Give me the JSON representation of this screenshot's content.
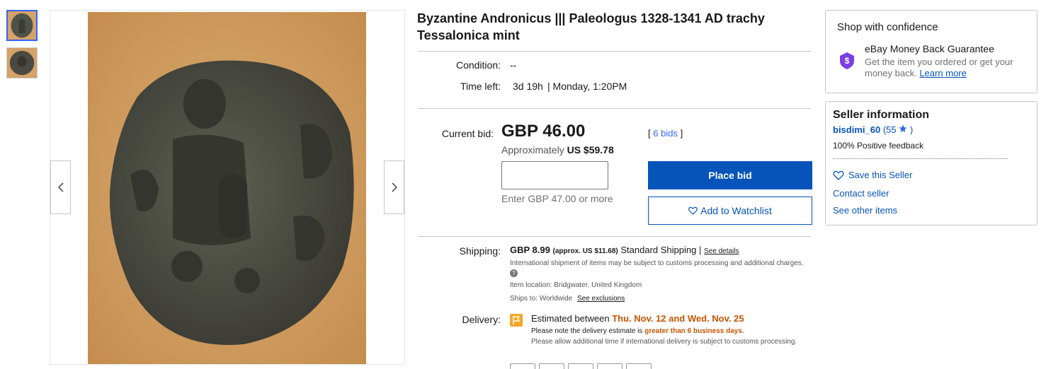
{
  "gallery": {
    "prev_icon": "chevron-left-icon",
    "next_icon": "chevron-right-icon"
  },
  "listing": {
    "title": "Byzantine Andronicus ||| Paleologus 1328-1341 AD trachy Tessalonica mint",
    "condition_label": "Condition:",
    "condition_value": "--",
    "time_left_label": "Time left:",
    "time_left_value": "3d 19h",
    "end_time": "| Monday, 1:20PM"
  },
  "bid": {
    "current_label": "Current bid:",
    "price": "GBP 46.00",
    "approx_prefix": "Approximately",
    "approx_value": "US $59.78",
    "bids_open": "[",
    "bids_link": "6 bids",
    "bids_close": "]",
    "input_value": "",
    "hint": "Enter GBP 47.00 or more",
    "place_bid": "Place bid",
    "watchlist": "Add to Watchlist"
  },
  "shipping": {
    "label": "Shipping:",
    "price": "GBP 8.99",
    "approx": "(approx. US $11.68)",
    "method": "Standard Shipping",
    "sep": "|",
    "details_link": "See details",
    "intl_note": "International shipment of items may be subject to customs processing and additional charges.",
    "location_label": "Item location:",
    "location_value": "Bridgwater, United Kingdom",
    "ships_label": "Ships to:",
    "ships_value": "Worldwide",
    "exclusions_link": "See exclusions"
  },
  "delivery": {
    "label": "Delivery:",
    "estimated_prefix": "Estimated between",
    "dates": "Thu. Nov. 12 and Wed. Nov. 25",
    "note_prefix": "Please note the delivery estimate is",
    "note_highlight": "greater than 6 business days.",
    "allow_note": "Please allow additional time if international delivery is subject to customs processing."
  },
  "confidence": {
    "title": "Shop with confidence",
    "guarantee_title": "eBay Money Back Guarantee",
    "guarantee_desc": "Get the item you ordered or get your money back.",
    "learn_more": "Learn more"
  },
  "seller": {
    "title": "Seller information",
    "name": "bisdimi_60",
    "score_open": "(",
    "score": "55",
    "score_close": ")",
    "feedback": "100% Positive feedback",
    "save": "Save this Seller",
    "contact": "Contact seller",
    "other_items": "See other items"
  },
  "colors": {
    "primary_button": "#0654ba",
    "link": "#0654ba",
    "highlight_orange": "#c45500",
    "shield_purple": "#7b3fe4"
  }
}
